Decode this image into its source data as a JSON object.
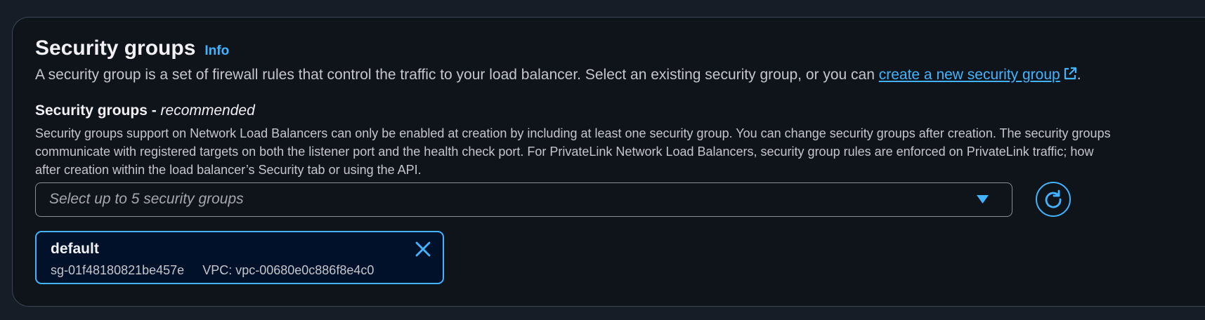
{
  "header": {
    "title": "Security groups",
    "info_label": "Info"
  },
  "description": {
    "text": "A security group is a set of firewall rules that control the traffic to your load balancer. Select an existing security group, or you can ",
    "link_text": "create a new security group",
    "suffix": "."
  },
  "field": {
    "label": "Security groups - ",
    "label_qualifier": "recommended",
    "constraint_lines": [
      "Security groups support on Network Load Balancers can only be enabled at creation by including at least one security group. You can change security groups after creation. The security groups",
      "communicate with registered targets on both the listener port and the health check port. For PrivateLink Network Load Balancers, security group rules are enforced on PrivateLink traffic; how",
      "after creation within the load balancer’s Security tab or using the API."
    ]
  },
  "select": {
    "placeholder": "Select up to 5 security groups"
  },
  "token": {
    "name": "default",
    "id": "sg-01f48180821be457e",
    "vpc": "VPC: vpc-00680e0c886f8e4c0"
  },
  "icons": {
    "external": "external-link-icon",
    "caret": "caret-down-icon",
    "refresh": "refresh-icon",
    "close": "close-icon"
  },
  "colors": {
    "background": "#161d26",
    "panel": "#0f141a",
    "accent": "#42b4ff",
    "token_bg": "#001129"
  }
}
